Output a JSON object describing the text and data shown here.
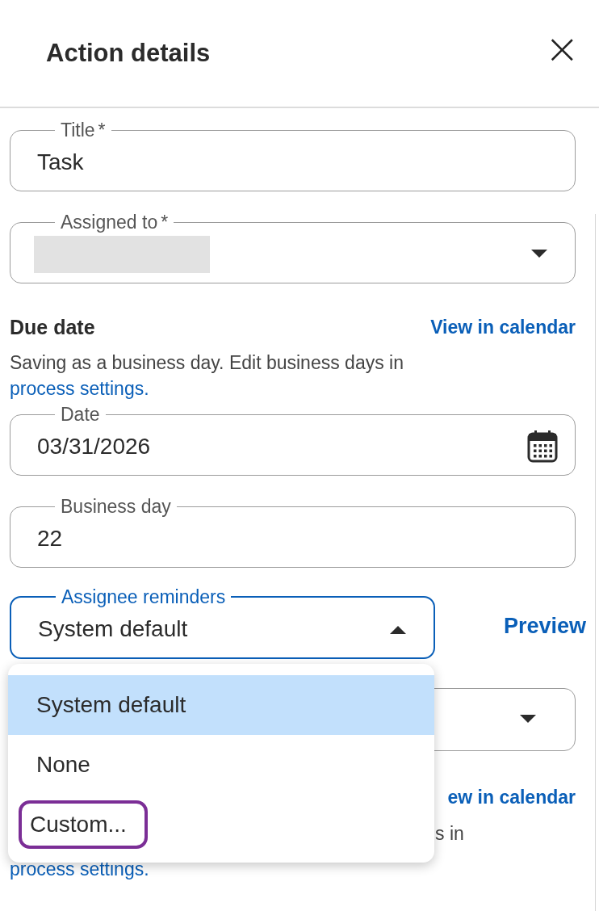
{
  "header": {
    "title": "Action details",
    "close": "×"
  },
  "title_field": {
    "label": "Title",
    "required_mark": "*",
    "value": "Task"
  },
  "assigned_field": {
    "label": "Assigned to",
    "required_mark": "*",
    "value_redacted": true
  },
  "due_date": {
    "heading": "Due date",
    "calendar_link": "View in calendar",
    "note": "Saving as a business day. Edit business days in",
    "settings_link": "process settings."
  },
  "date_field": {
    "label": "Date",
    "value": "03/31/2026"
  },
  "business_day_field": {
    "label": "Business day",
    "value": "22"
  },
  "reminders": {
    "label": "Assignee reminders",
    "value": "System default",
    "expanded": true,
    "preview_link": "Preview",
    "options": [
      {
        "label": "System default",
        "selected": true,
        "highlighted": false
      },
      {
        "label": "None",
        "selected": false,
        "highlighted": false
      },
      {
        "label": "Custom...",
        "selected": false,
        "highlighted": true
      }
    ]
  },
  "lower_section": {
    "calendar_link": "ew in calendar",
    "note": "s in",
    "settings_link": "process settings."
  }
}
